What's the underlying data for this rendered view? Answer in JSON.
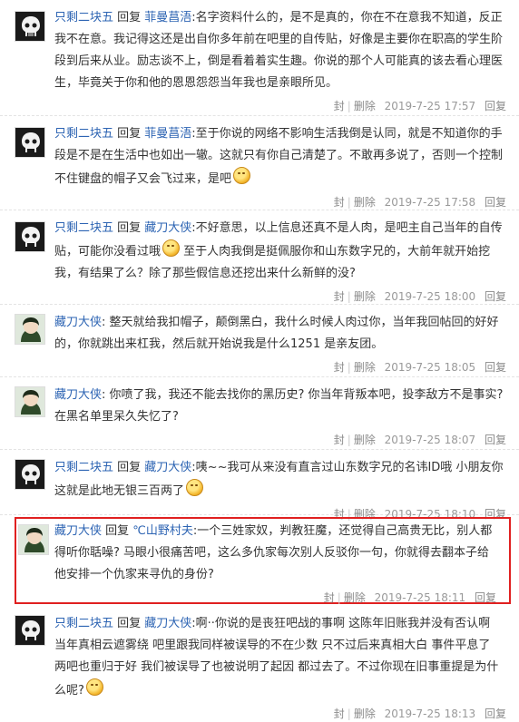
{
  "actions": {
    "feng": "封",
    "delete": "删除",
    "reply": "回复"
  },
  "avatars": {
    "punisher": "punisher-skull-icon",
    "daodao": "anime-character-icon"
  },
  "replies": [
    {
      "avatar": "punisher",
      "author": "只剩二块五",
      "reply_word": "回复",
      "target": "菲曼菖浯",
      "text": ":名字资料什么的，是不是真的，你在不在意我不知道，反正我不在意。我记得这还是出自你多年前在吧里的自传贴，好像是主要你在职高的学生阶段到后来从业。励志谈不上，倒是看着着实生趣。你说的那个人可能真的该去看心理医生，毕竟关于你和他的恩恩怨怨当年我也是亲眼所见。",
      "emoji": false,
      "time": "2019-7-25 17:57"
    },
    {
      "avatar": "punisher",
      "author": "只剩二块五",
      "reply_word": "回复",
      "target": "菲曼菖浯",
      "text": ":至于你说的网络不影响生活我倒是认同，就是不知道你的手段是不是在生活中也如出一辙。这就只有你自己清楚了。不敢再多说了，否则一个控制不住键盘的帽子又会飞过来，是吧",
      "emoji": true,
      "time": "2019-7-25 17:58"
    },
    {
      "avatar": "punisher",
      "author": "只剩二块五",
      "reply_word": "回复",
      "target": "藏刀大侠",
      "text": ":不好意思，以上信息还真不是人肉，是吧主自己当年的自传贴，可能你没看过哦",
      "text2": " 至于人肉我倒是挺佩服你和山东数字兄的，大前年就开始挖我，有结果了么？除了那些假信息还挖出来什么新鲜的没?",
      "emoji": true,
      "time": "2019-7-25 18:00"
    },
    {
      "avatar": "daodao",
      "author": "藏刀大侠",
      "reply_word": "",
      "target": "",
      "text": ": 整天就给我扣帽子，颠倒黑白，我什么时候人肉过你，当年我回帖回的好好的，你就跳出来杠我，然后就开始说我是什么1251 是亲友团。",
      "emoji": false,
      "time": "2019-7-25 18:05"
    },
    {
      "avatar": "daodao",
      "author": "藏刀大侠",
      "reply_word": "",
      "target": "",
      "text": ": 你喷了我，我还不能去找你的黑历史? 你当年背叛本吧，投李敌方不是事实? 在黑名单里呆久失忆了?",
      "emoji": false,
      "time": "2019-7-25 18:07"
    },
    {
      "avatar": "punisher",
      "author": "只剩二块五",
      "reply_word": "回复",
      "target": "藏刀大侠",
      "text": ":咦~~我可从来没有直言过山东数字兄的名讳ID哦 小朋友你这就是此地无银三百两了",
      "emoji": true,
      "time": "2019-7-25 18:10"
    },
    {
      "avatar": "daodao",
      "author": "藏刀大侠",
      "reply_word": "回复",
      "target": "℃山野村夫",
      "text": ":一个三姓家奴，判教狂魔，还觉得自己高贵无比，别人都得听你聒噪? 马眼小很痛苦吧，这么多仇家每次别人反驳你一句，你就得去翻本子给他安排一个仇家来寻仇的身份?",
      "emoji": false,
      "time": "2019-7-25 18:11",
      "highlight": true
    },
    {
      "avatar": "punisher",
      "author": "只剩二块五",
      "reply_word": "回复",
      "target": "藏刀大侠",
      "text": ":啊··你说的是丧狂吧战的事啊 这陈年旧账我并没有否认啊 当年真相云遮雾绕 吧里跟我同样被误导的不在少数 只不过后来真相大白 事件平息了 两吧也重归于好 我们被误导了也被说明了起因 都过去了。不过你现在旧事重提是为什么呢?",
      "emoji": true,
      "time": "2019-7-25 18:13"
    }
  ]
}
